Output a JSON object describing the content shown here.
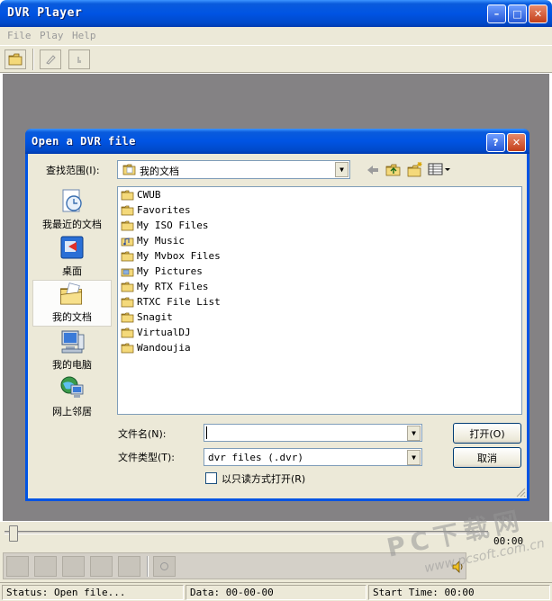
{
  "window": {
    "title": "DVR Player",
    "min_glyph": "–",
    "max_glyph": "□",
    "close_glyph": "✕"
  },
  "menu": {
    "file": "File",
    "play": "Play",
    "help": "Help"
  },
  "dialog": {
    "title": "Open a DVR file",
    "help_glyph": "?",
    "close_glyph": "✕",
    "look_in_label": "查找范围(I):",
    "look_in_value": "我的文档",
    "places": [
      {
        "label": "我最近的文档",
        "icon": "recent-documents-icon"
      },
      {
        "label": "桌面",
        "icon": "desktop-icon"
      },
      {
        "label": "我的文档",
        "icon": "my-documents-icon",
        "selected": true
      },
      {
        "label": "我的电脑",
        "icon": "my-computer-icon"
      },
      {
        "label": "网上邻居",
        "icon": "network-places-icon"
      }
    ],
    "files": [
      "CWUB",
      "Favorites",
      "My ISO Files",
      "My Music",
      "My Mvbox Files",
      "My Pictures",
      "My RTX Files",
      "RTXC File List",
      "Snagit",
      "VirtualDJ",
      "Wandoujia"
    ],
    "filename_label": "文件名(N):",
    "filename_value": "",
    "filetype_label": "文件类型(T):",
    "filetype_value": "dvr files (.dvr)",
    "readonly_label": "以只读方式打开(R)",
    "open_button": "打开(O)",
    "cancel_button": "取消"
  },
  "player": {
    "time": "00:00",
    "progress": 0
  },
  "status": {
    "status": "Status: Open file...",
    "data": "Data: 00-00-00",
    "start_time": "Start Time: 00:00"
  },
  "watermark": {
    "main": "PC下载网",
    "sub": "www.pcsoft.com.cn"
  }
}
